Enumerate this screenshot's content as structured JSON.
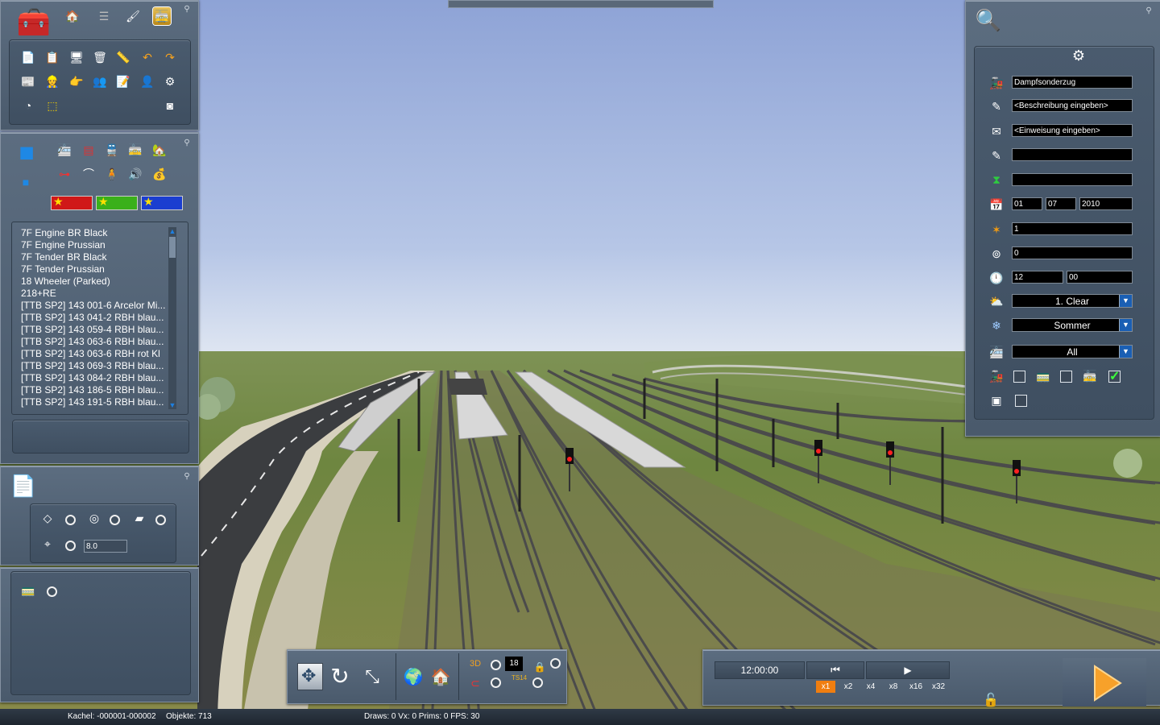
{
  "top_toolbar": {
    "tools": [
      {
        "icon": "toolbox-icon"
      },
      {
        "icon": "home-icon"
      },
      {
        "icon": "track-icon"
      },
      {
        "icon": "brush-icon"
      },
      {
        "icon": "train-editor-icon"
      }
    ]
  },
  "object_list": {
    "items": [
      "7F Engine BR Black",
      "7F Engine Prussian",
      "7F Tender BR Black",
      "7F Tender Prussian",
      "18 Wheeler (Parked)",
      "218+RE",
      "[TTB SP2] 143 001-6 Arcelor Mi...",
      "[TTB SP2] 143 041-2 RBH blau...",
      "[TTB SP2] 143 059-4 RBH blau...",
      "[TTB SP2] 143 063-6 RBH blau...",
      "[TTB SP2] 143 063-6 RBH rot Kl",
      "[TTB SP2] 143 069-3 RBH blau...",
      "[TTB SP2] 143 084-2 RBH blau...",
      "[TTB SP2] 143 186-5 RBH blau...",
      "[TTB SP2] 143 191-5 RBH blau..."
    ]
  },
  "layer_panel": {
    "value": "8.0"
  },
  "scenario": {
    "name": "Dampfsonderzug",
    "description_placeholder": "<Beschreibung eingeben>",
    "briefing_placeholder": "<Einweisung eingeben>",
    "author": "",
    "start_location": "",
    "date": {
      "day": "01",
      "month": "07",
      "year": "2010"
    },
    "rating": "1",
    "duration": "0",
    "start_time": {
      "hour": "12",
      "minute": "00"
    },
    "weather": "1. Clear",
    "season": "Sommer",
    "filter": "All",
    "filter_checks": [
      false,
      false,
      true
    ],
    "extra_check": false
  },
  "bottom_toolbar": {
    "layer_number": "18",
    "ts_label": "TS14"
  },
  "time_panel": {
    "clock": "12:00:00",
    "speeds": [
      "x1",
      "x2",
      "x4",
      "x8",
      "x16",
      "x32"
    ],
    "active_speed": "x1"
  },
  "status": {
    "tile": "Kachel: -000001-000002",
    "objects": "Objekte: 713",
    "stats": "Draws: 0 Vx: 0 Prims: 0 FPS: 30"
  },
  "colors": {
    "accent": "#f07e10",
    "panel": "#4e5e70",
    "sky_top": "#8fa6d8",
    "grass": "#67803a"
  }
}
